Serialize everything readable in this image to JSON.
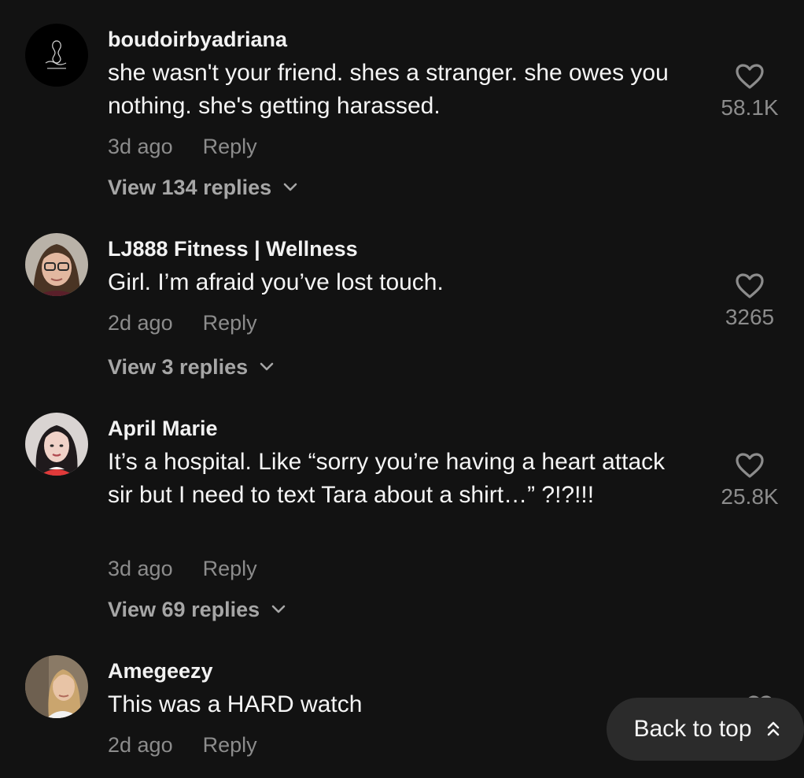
{
  "comments": [
    {
      "username": "boudoirbyadriana",
      "text": "she wasn't your friend. shes a stranger. she owes you nothing. she's getting harassed.",
      "time": "3d ago",
      "reply_label": "Reply",
      "view_replies": "View 134 replies",
      "likes": "58.1K",
      "avatar_icon": "boudoir-logo-avatar"
    },
    {
      "username": "LJ888 Fitness | Wellness",
      "text": "Girl. I’m afraid you’ve lost touch.",
      "time": "2d ago",
      "reply_label": "Reply",
      "view_replies": "View 3 replies",
      "likes": "3265",
      "avatar_icon": "woman-glasses-avatar"
    },
    {
      "username": "April Marie",
      "text": "It’s a hospital. Like “sorry you’re having a heart attack sir but I need to text Tara about a shirt…” ?!?!!!",
      "time": "3d ago",
      "reply_label": "Reply",
      "view_replies": "View 69 replies",
      "likes": "25.8K",
      "avatar_icon": "woman-dark-hair-avatar"
    },
    {
      "username": "Amegeezy",
      "text": "This was a HARD watch",
      "time": "2d ago",
      "reply_label": "Reply",
      "avatar_icon": "woman-blonde-avatar"
    }
  ],
  "back_to_top": {
    "label": "Back to top",
    "icon": "double-chevron-up-icon"
  },
  "colors": {
    "background": "#121212",
    "text_primary": "#f5f5f5",
    "text_secondary": "#8c8c8c",
    "pill_background": "#2b2b2b"
  }
}
